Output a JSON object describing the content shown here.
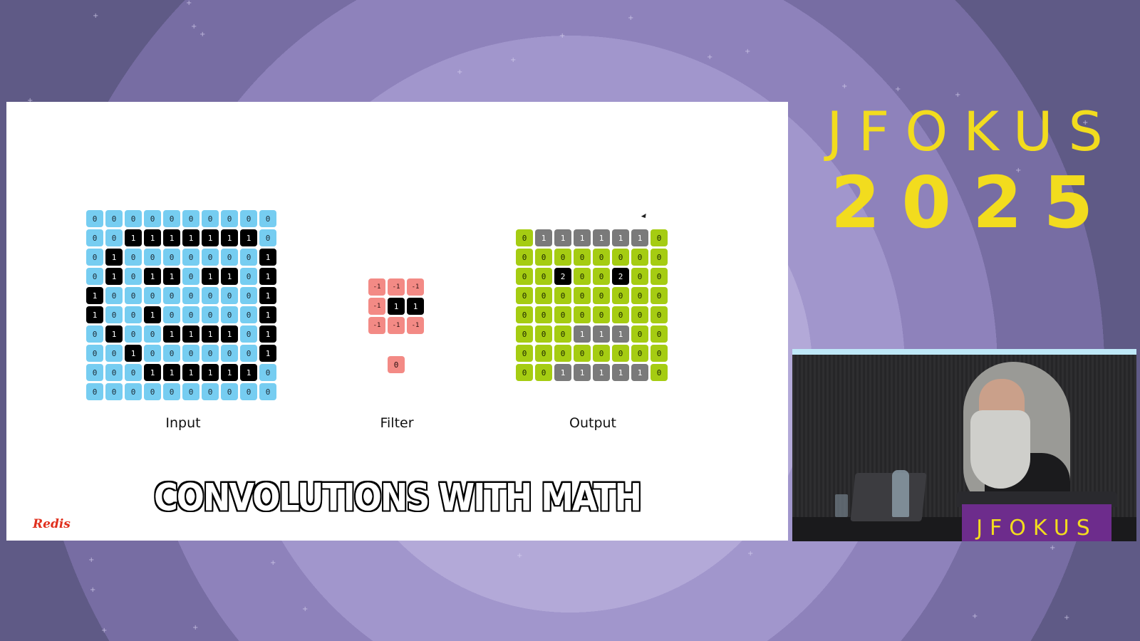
{
  "conference": {
    "name": "JFOKUS",
    "year": "2025"
  },
  "slide": {
    "title": "CONVOLUTIONS WITH MATH",
    "logo": "Redis",
    "input": {
      "label": "Input",
      "matrix": [
        [
          0,
          0,
          0,
          0,
          0,
          0,
          0,
          0,
          0,
          0
        ],
        [
          0,
          0,
          1,
          1,
          1,
          1,
          1,
          1,
          1,
          0
        ],
        [
          0,
          1,
          0,
          0,
          0,
          0,
          0,
          0,
          0,
          1
        ],
        [
          0,
          1,
          0,
          1,
          1,
          0,
          1,
          1,
          0,
          1
        ],
        [
          1,
          0,
          0,
          0,
          0,
          0,
          0,
          0,
          0,
          1
        ],
        [
          1,
          0,
          0,
          1,
          0,
          0,
          0,
          0,
          0,
          1
        ],
        [
          0,
          1,
          0,
          0,
          1,
          1,
          1,
          1,
          0,
          1
        ],
        [
          0,
          0,
          1,
          0,
          0,
          0,
          0,
          0,
          0,
          1
        ],
        [
          0,
          0,
          0,
          1,
          1,
          1,
          1,
          1,
          1,
          0
        ],
        [
          0,
          0,
          0,
          0,
          0,
          0,
          0,
          0,
          0,
          0
        ]
      ]
    },
    "filter": {
      "label": "Filter",
      "matrix": [
        [
          -1,
          -1,
          -1
        ],
        [
          -1,
          1,
          1
        ],
        [
          -1,
          -1,
          -1
        ]
      ],
      "result": "0"
    },
    "output": {
      "label": "Output",
      "matrix": [
        [
          0,
          1,
          1,
          1,
          1,
          1,
          1,
          0
        ],
        [
          0,
          0,
          0,
          0,
          0,
          0,
          0,
          0
        ],
        [
          0,
          0,
          2,
          0,
          0,
          2,
          0,
          0
        ],
        [
          0,
          0,
          0,
          0,
          0,
          0,
          0,
          0
        ],
        [
          0,
          0,
          0,
          0,
          0,
          0,
          0,
          0
        ],
        [
          0,
          0,
          0,
          1,
          1,
          1,
          0,
          0
        ],
        [
          0,
          0,
          0,
          0,
          0,
          0,
          0,
          0
        ],
        [
          0,
          0,
          1,
          1,
          1,
          1,
          1,
          0
        ]
      ]
    }
  },
  "video": {
    "podium_text": "JFOKUS"
  },
  "colors": {
    "input_zero": "#76cdf1",
    "input_one": "#000000",
    "filter_negative": "#f38a85",
    "output_zero": "#a5cc12",
    "output_one": "#7a7a7a",
    "output_two": "#000000",
    "conference_yellow": "#f2dc1e"
  }
}
